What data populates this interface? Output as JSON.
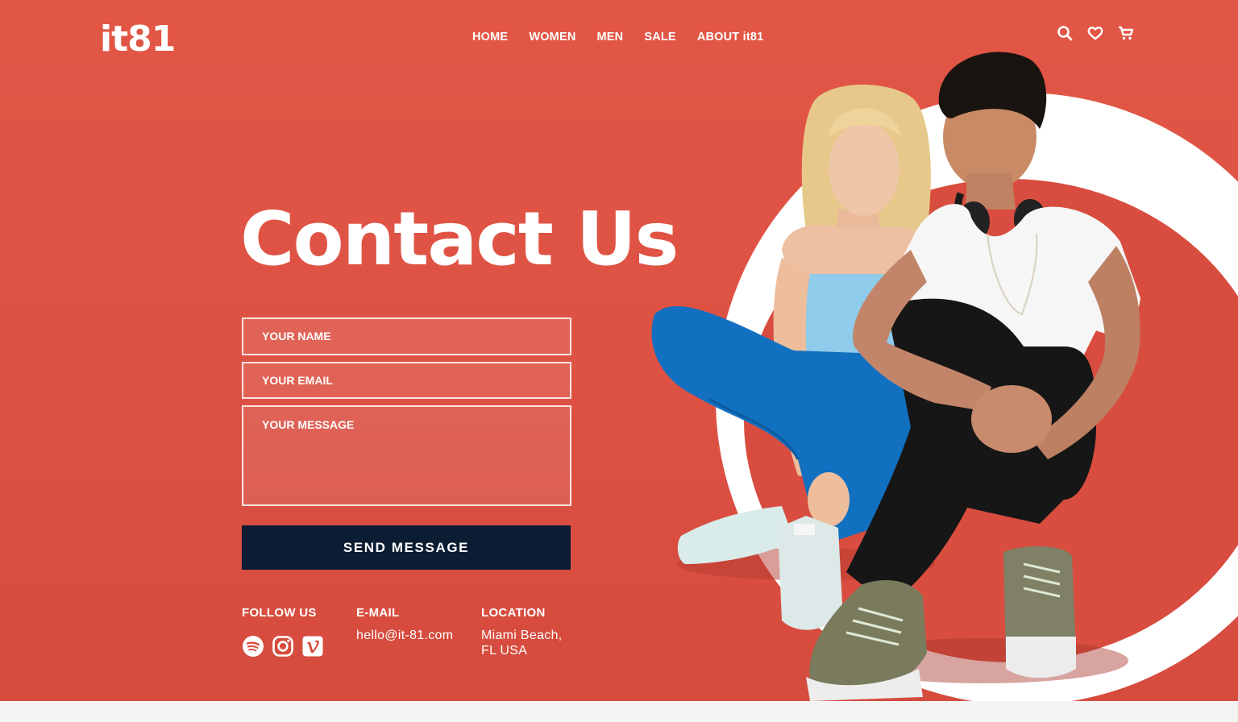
{
  "brand": {
    "logo_text": "it81"
  },
  "nav": {
    "items": [
      {
        "label": "HOME"
      },
      {
        "label": "WOMEN"
      },
      {
        "label": "MEN"
      },
      {
        "label": "SALE"
      },
      {
        "label": "ABOUT it81"
      }
    ],
    "icons": [
      "search-icon",
      "heart-icon",
      "cart-icon"
    ]
  },
  "page": {
    "title": "Contact Us"
  },
  "form": {
    "name_placeholder": "YOUR NAME",
    "email_placeholder": "YOUR EMAIL",
    "message_placeholder": "YOUR MESSAGE",
    "submit_label": "SEND MESSAGE"
  },
  "info": {
    "follow_heading": "FOLLOW US",
    "social_icons": [
      "spotify-icon",
      "instagram-icon",
      "vimeo-icon"
    ],
    "email_heading": "E-MAIL",
    "email_value": "hello@it-81.com",
    "location_heading": "LOCATION",
    "location_line1": "Miami Beach,",
    "location_line2": "FL USA"
  },
  "colors": {
    "hero_bg": "#e05445",
    "button_bg": "#0c1c33",
    "ring": "#ffffff",
    "bottom_bg": "#f3f3f3"
  }
}
